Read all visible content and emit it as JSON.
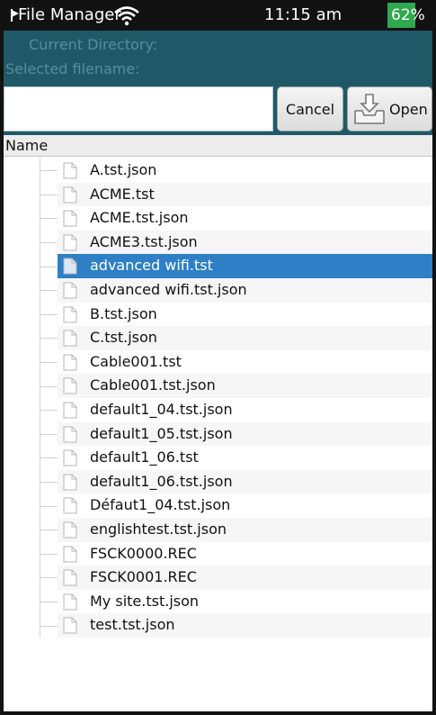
{
  "status_bar": {
    "app_title": "File Manager",
    "time": "11:15 am",
    "battery_label": "62%",
    "battery_level": 62
  },
  "header": {
    "current_directory_label": "Current Directory:",
    "selected_filename_label": "Selected filename:",
    "filename_value": "",
    "cancel_label": "Cancel",
    "open_label": "Open"
  },
  "list": {
    "column_name": "Name",
    "selected_index": 4,
    "files": [
      "A.tst.json",
      "ACME.tst",
      "ACME.tst.json",
      "ACME3.tst.json",
      "advanced wifi.tst",
      "advanced wifi.tst.json",
      "B.tst.json",
      "C.tst.json",
      "Cable001.tst",
      "Cable001.tst.json",
      "default1_04.tst.json",
      "default1_05.tst.json",
      "default1_06.tst",
      "default1_06.tst.json",
      "Défaut1_04.tst.json",
      "englishtest.tst.json",
      "FSCK0000.REC",
      "FSCK0001.REC",
      "My site.tst.json",
      "test.tst.json"
    ]
  },
  "colors": {
    "status_bar": "#121212",
    "header_bg": "#1f5968",
    "header_text": "#5b8aa3",
    "selection": "#2e7fc6",
    "battery": "#2fa84f"
  },
  "icons": {
    "signal": "wifi-icon",
    "open": "open-file-icon",
    "file": "document-icon"
  }
}
